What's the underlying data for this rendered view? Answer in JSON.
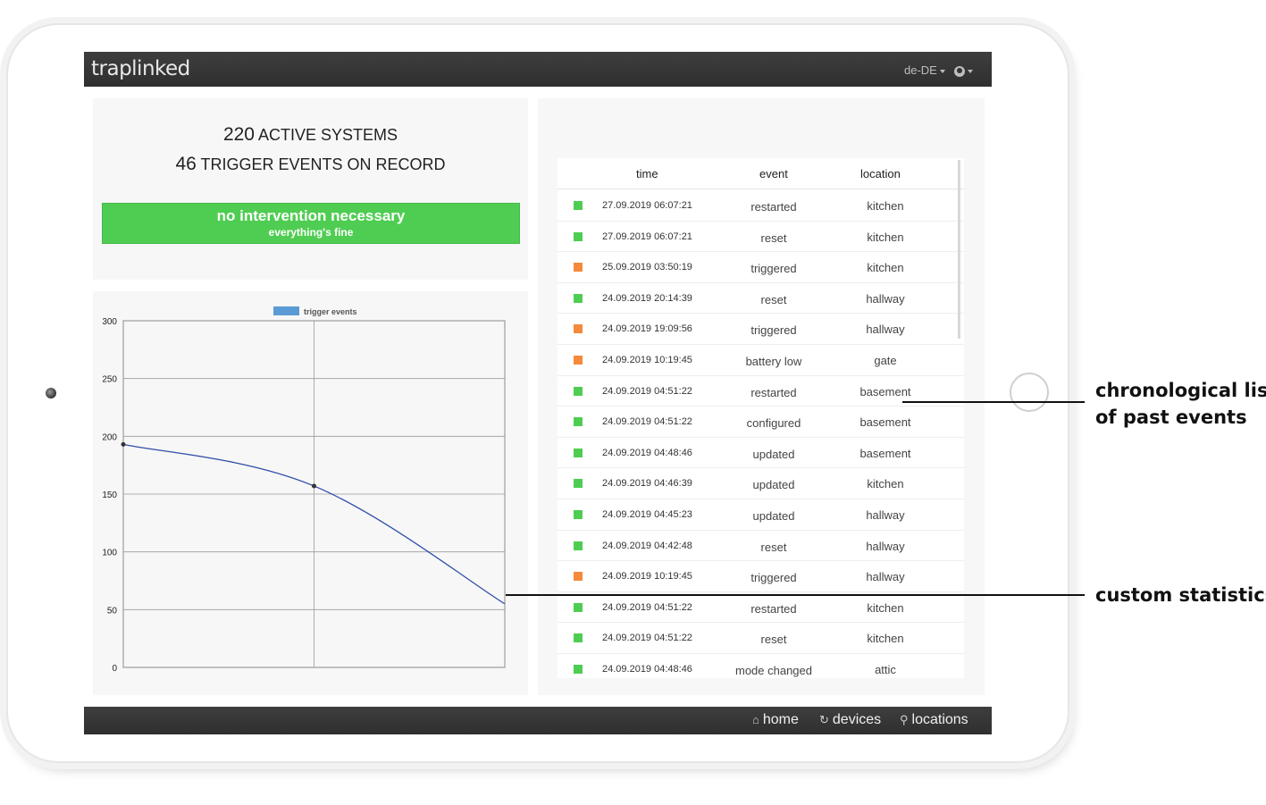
{
  "app": {
    "logo": "traplinked",
    "language": "de-DE",
    "user_icon": "user-circle-icon"
  },
  "summary": {
    "active_count": "220",
    "active_label": "ACTIVE SYSTEMS",
    "trigger_count": "46",
    "trigger_label": "TRIGGER EVENTS ON RECORD",
    "status_main": "no intervention necessary",
    "status_sub": "everything's fine",
    "status_color": "#4fcd52"
  },
  "chart_data": {
    "type": "line",
    "legend": "trigger events",
    "legend_color": "#5b9bd5",
    "line_color": "#2f4ea8",
    "x": [
      0,
      1,
      2
    ],
    "values": [
      193,
      157,
      55
    ],
    "ylim": [
      0,
      300
    ],
    "yticks": [
      "300",
      "250",
      "200",
      "150",
      "100",
      "50",
      "0"
    ],
    "grid": true
  },
  "events": {
    "headers": {
      "time": "time",
      "event": "event",
      "location": "location"
    },
    "colors": {
      "ok": "#4fcd52",
      "warn": "#f58a3c"
    },
    "rows": [
      {
        "status": "ok",
        "time": "27.09.2019 06:07:21",
        "event": "restarted",
        "location": "kitchen"
      },
      {
        "status": "ok",
        "time": "27.09.2019 06:07:21",
        "event": "reset",
        "location": "kitchen"
      },
      {
        "status": "warn",
        "time": "25.09.2019 03:50:19",
        "event": "triggered",
        "location": "kitchen"
      },
      {
        "status": "ok",
        "time": "24.09.2019 20:14:39",
        "event": "reset",
        "location": "hallway"
      },
      {
        "status": "warn",
        "time": "24.09.2019 19:09:56",
        "event": "triggered",
        "location": "hallway"
      },
      {
        "status": "warn",
        "time": "24.09.2019 10:19:45",
        "event": "battery low",
        "location": "gate"
      },
      {
        "status": "ok",
        "time": "24.09.2019 04:51:22",
        "event": "restarted",
        "location": "basement"
      },
      {
        "status": "ok",
        "time": "24.09.2019 04:51:22",
        "event": "configured",
        "location": "basement"
      },
      {
        "status": "ok",
        "time": "24.09.2019 04:48:46",
        "event": "updated",
        "location": "basement"
      },
      {
        "status": "ok",
        "time": "24.09.2019 04:46:39",
        "event": "updated",
        "location": "kitchen"
      },
      {
        "status": "ok",
        "time": "24.09.2019 04:45:23",
        "event": "updated",
        "location": "hallway"
      },
      {
        "status": "ok",
        "time": "24.09.2019 04:42:48",
        "event": "reset",
        "location": "hallway"
      },
      {
        "status": "warn",
        "time": "24.09.2019 10:19:45",
        "event": "triggered",
        "location": "hallway"
      },
      {
        "status": "ok",
        "time": "24.09.2019 04:51:22",
        "event": "restarted",
        "location": "kitchen"
      },
      {
        "status": "ok",
        "time": "24.09.2019 04:51:22",
        "event": "reset",
        "location": "kitchen"
      },
      {
        "status": "ok",
        "time": "24.09.2019 04:48:46",
        "event": "mode changed",
        "location": "attic"
      }
    ]
  },
  "nav": {
    "home": "home",
    "devices": "devices",
    "locations": "locations"
  },
  "annotations": {
    "list_line1": "chronological list",
    "list_line2": "of past events",
    "stats": "custom statistics"
  }
}
